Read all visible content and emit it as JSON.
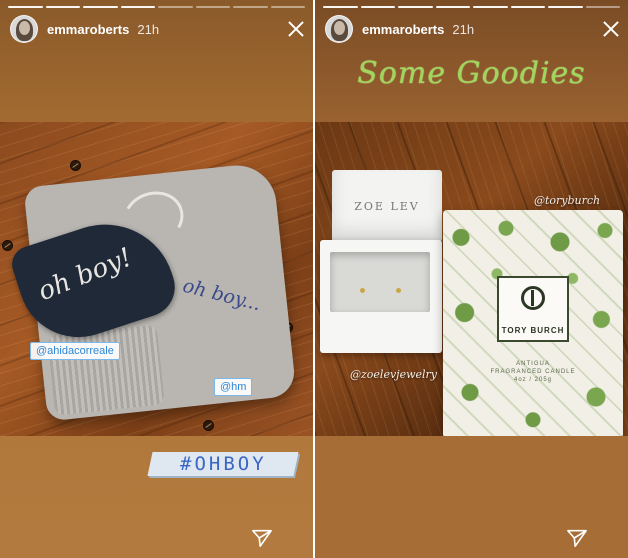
{
  "stories": [
    {
      "progress_segments": 8,
      "progress_done": 4,
      "username": "emmaroberts",
      "time": "21h",
      "mask_text": "oh boy!",
      "embroidery_text": "oh boy...",
      "tags": [
        {
          "text": "@ahidacorreale"
        },
        {
          "text": "@hm"
        }
      ],
      "hashtag": "#OHBOY"
    },
    {
      "progress_segments": 8,
      "progress_done": 7,
      "username": "emmaroberts",
      "time": "21h",
      "heading": "Some Goodies",
      "jewelry_box_label": "ZOE LEV",
      "tags": [
        {
          "text": "@toryburch"
        },
        {
          "text": "@zoelevjewelry"
        }
      ],
      "candle": {
        "brand": "TORY BURCH",
        "desc_line1": "ANTIGUA",
        "desc_line2": "FRAGRANCED CANDLE",
        "desc_line3": "4oz / 205g"
      }
    }
  ],
  "icons": {
    "close": "close-icon",
    "send": "send-icon"
  }
}
